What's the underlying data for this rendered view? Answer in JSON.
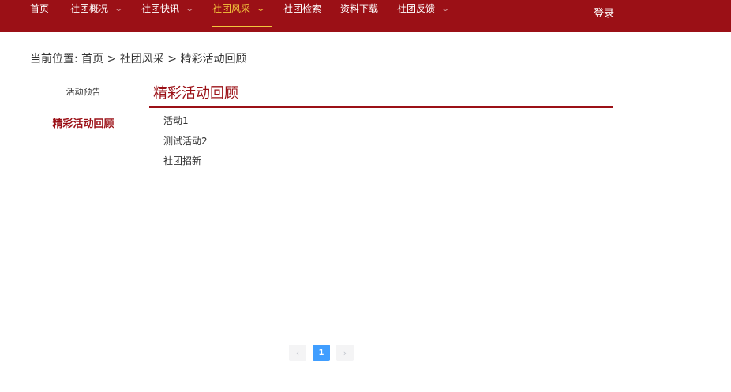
{
  "nav": {
    "items": [
      {
        "label": "首页",
        "has_dropdown": false,
        "active": false
      },
      {
        "label": "社团概况",
        "has_dropdown": true,
        "active": false
      },
      {
        "label": "社团快讯",
        "has_dropdown": true,
        "active": false
      },
      {
        "label": "社团风采",
        "has_dropdown": true,
        "active": true
      },
      {
        "label": "社团检索",
        "has_dropdown": false,
        "active": false
      },
      {
        "label": "资料下载",
        "has_dropdown": false,
        "active": false
      },
      {
        "label": "社团反馈",
        "has_dropdown": true,
        "active": false
      }
    ],
    "chevron": "⌄",
    "login": "登录"
  },
  "breadcrumb": {
    "prefix": "当前位置:",
    "items": [
      "首页",
      "社团风采",
      "精彩活动回顾"
    ],
    "separator": ">"
  },
  "sidebar": {
    "items": [
      {
        "label": "活动预告",
        "active": false
      },
      {
        "label": "精彩活动回顾",
        "active": true
      }
    ]
  },
  "content": {
    "title": "精彩活动回顾",
    "items": [
      "活动1",
      "测试活动2",
      "社团招新"
    ]
  },
  "pagination": {
    "prev": "‹",
    "current": "1",
    "next": "›"
  },
  "colors": {
    "brand": "#9b1016",
    "active_nav": "#f3c63d",
    "pager_active": "#409eff"
  }
}
